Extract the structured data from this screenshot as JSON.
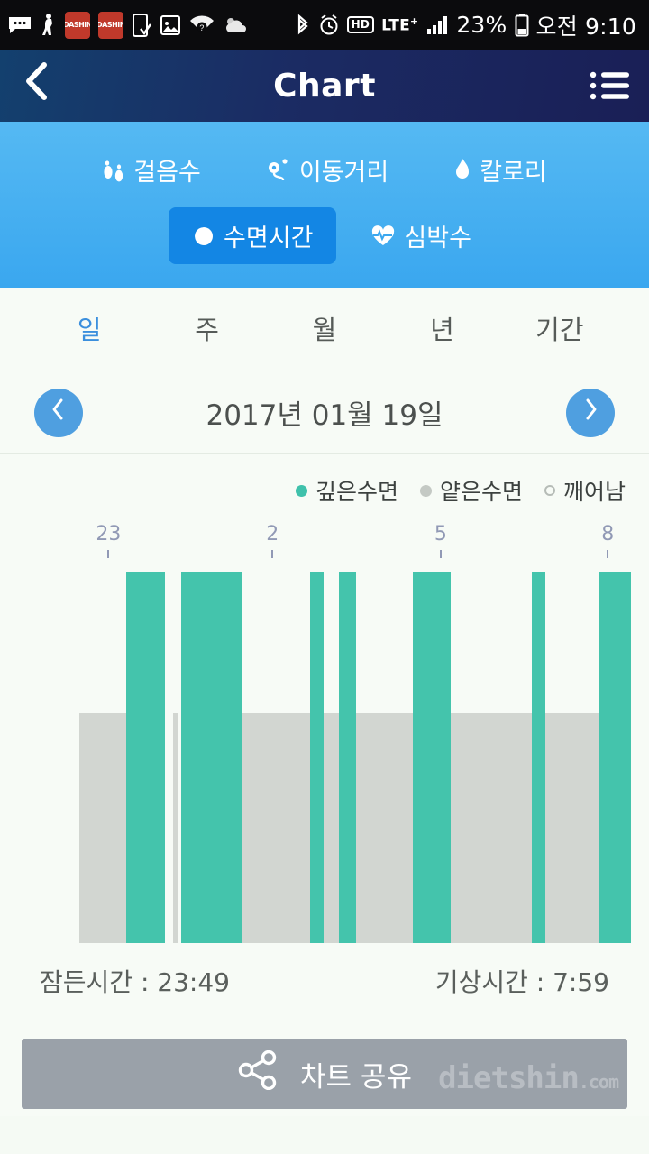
{
  "statusbar": {
    "icons": [
      "message-icon",
      "fitness-icon",
      "dashin-badge-icon",
      "dashin-badge-icon",
      "phone-check-icon",
      "sd-card-icon",
      "wifi-question-icon",
      "weather-icon",
      "bluetooth-icon",
      "alarm-icon",
      "hd-icon",
      "lte-plus-icon",
      "signal-icon"
    ],
    "badge_text": "DASHIN",
    "hd_label": "HD",
    "lte_label": "LTE",
    "lte_sup": "+",
    "battery_percent": "23%",
    "time": "오전 9:10"
  },
  "header": {
    "back_icon": "chevron-left-icon",
    "title": "Chart",
    "menu_icon": "list-menu-icon"
  },
  "metrics": {
    "row1": [
      {
        "label": "걸음수",
        "icon": "footprints-icon",
        "active": false
      },
      {
        "label": "이동거리",
        "icon": "route-pin-icon",
        "active": false
      },
      {
        "label": "칼로리",
        "icon": "flame-icon",
        "active": false
      }
    ],
    "row2": [
      {
        "label": "수면시간",
        "icon": "moon-icon",
        "active": true
      },
      {
        "label": "심박수",
        "icon": "heartbeat-icon",
        "active": false
      }
    ],
    "active_color": "#1386e4"
  },
  "periods": [
    {
      "label": "일",
      "active": true
    },
    {
      "label": "주",
      "active": false
    },
    {
      "label": "월",
      "active": false
    },
    {
      "label": "년",
      "active": false
    },
    {
      "label": "기간",
      "active": false
    }
  ],
  "date_nav": {
    "prev_icon": "chevron-left-icon",
    "next_icon": "chevron-right-icon",
    "date": "2017년 01월 19일"
  },
  "legend": [
    {
      "label": "깊은수면",
      "swatch": "deep",
      "color": "#3fc1ab"
    },
    {
      "label": "얕은수면",
      "swatch": "light",
      "color": "#c4c9c4"
    },
    {
      "label": "깨어남",
      "swatch": "awake",
      "color": "#ffffff"
    }
  ],
  "summary": {
    "sleep_label": "잠든시간 : 23:49",
    "wake_label": "기상시간 : 7:59"
  },
  "share": {
    "icon": "share-nodes-icon",
    "label": "차트 공유"
  },
  "watermark": {
    "text": "dietshin",
    "suffix": ".com"
  },
  "chart_data": {
    "type": "bar",
    "title": "수면시간",
    "xlabel": "",
    "ylabel": "",
    "grid": false,
    "legend_position": "top-right",
    "x_ticks": [
      {
        "label": "23",
        "pct": 5.3
      },
      {
        "label": "2",
        "pct": 35.0
      },
      {
        "label": "5",
        "pct": 65.5
      },
      {
        "label": "8",
        "pct": 95.8
      }
    ],
    "x_range_hours": [
      23,
      8
    ],
    "sleep_start": "23:49",
    "sleep_end": "7:59",
    "series": [
      {
        "name": "깊은수면",
        "color": "#44c4ac",
        "level": "deep"
      },
      {
        "name": "얕은수면",
        "color": "#d2d6d1",
        "level": "light"
      },
      {
        "name": "깨어남",
        "color": "#ffffff",
        "level": "awake"
      }
    ],
    "segments": [
      {
        "level": "light",
        "start_pct": 0.0,
        "end_pct": 8.5
      },
      {
        "level": "deep",
        "start_pct": 8.5,
        "end_pct": 15.5
      },
      {
        "level": "awake",
        "start_pct": 15.5,
        "end_pct": 17.0
      },
      {
        "level": "light",
        "start_pct": 17.0,
        "end_pct": 18.0
      },
      {
        "level": "awake",
        "start_pct": 18.0,
        "end_pct": 18.5
      },
      {
        "level": "deep",
        "start_pct": 18.5,
        "end_pct": 29.4
      },
      {
        "level": "light",
        "start_pct": 29.4,
        "end_pct": 41.8
      },
      {
        "level": "deep",
        "start_pct": 41.8,
        "end_pct": 44.3
      },
      {
        "level": "light",
        "start_pct": 44.3,
        "end_pct": 47.0
      },
      {
        "level": "deep",
        "start_pct": 47.0,
        "end_pct": 50.2
      },
      {
        "level": "light",
        "start_pct": 50.2,
        "end_pct": 60.5
      },
      {
        "level": "deep",
        "start_pct": 60.5,
        "end_pct": 67.3
      },
      {
        "level": "light",
        "start_pct": 67.3,
        "end_pct": 82.0
      },
      {
        "level": "deep",
        "start_pct": 82.0,
        "end_pct": 84.5
      },
      {
        "level": "light",
        "start_pct": 84.5,
        "end_pct": 94.2
      },
      {
        "level": "deep",
        "start_pct": 94.2,
        "end_pct": 101.2
      },
      {
        "level": "light",
        "start_pct": 101.2,
        "end_pct": 106.0
      }
    ],
    "deep_bar_top_pct": 0,
    "light_bar_top_pct": 38
  }
}
